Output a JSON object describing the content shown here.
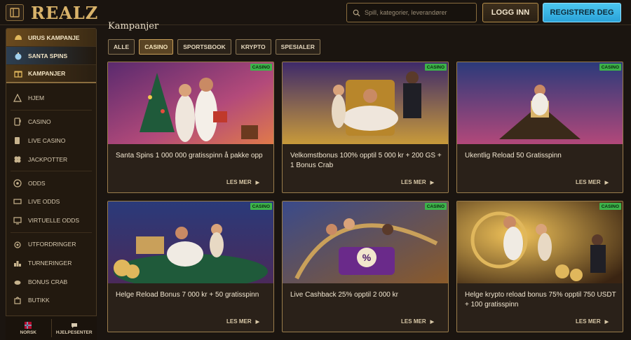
{
  "header": {
    "logo": "REALZ",
    "search_placeholder": "Spill, kategorier, leverandører",
    "login_label": "LOGG INN",
    "register_label": "REGISTRER DEG"
  },
  "sidebar": {
    "promos": [
      {
        "label": "URUS KAMPANJE",
        "icon": "helmet-icon"
      },
      {
        "label": "SANTA SPINS",
        "icon": "ornament-icon"
      },
      {
        "label": "KAMPANJER",
        "icon": "gift-icon"
      }
    ],
    "items": [
      {
        "label": "HJEM",
        "icon": "home-icon"
      },
      {
        "label": "CASINO",
        "icon": "slot-machine-icon"
      },
      {
        "label": "LIVE CASINO",
        "icon": "cards-icon"
      },
      {
        "label": "JACKPOTTER",
        "icon": "clover-icon"
      },
      {
        "label": "ODDS",
        "icon": "ball-icon"
      },
      {
        "label": "LIVE ODDS",
        "icon": "live-icon"
      },
      {
        "label": "VIRTUELLE ODDS",
        "icon": "virtual-icon"
      },
      {
        "label": "UTFORDRINGER",
        "icon": "medal-icon"
      },
      {
        "label": "TURNERINGER",
        "icon": "podium-icon"
      },
      {
        "label": "BONUS CRAB",
        "icon": "crab-icon"
      },
      {
        "label": "BUTIKK",
        "icon": "shop-icon"
      }
    ],
    "footer": {
      "language": "NORSK",
      "help": "HJELPESENTER"
    }
  },
  "main": {
    "title": "Kampanjer",
    "filters": [
      {
        "label": "ALLE",
        "active": false
      },
      {
        "label": "CASINO",
        "active": true
      },
      {
        "label": "SPORTSBOOK",
        "active": false
      },
      {
        "label": "KRYPTO",
        "active": false
      },
      {
        "label": "SPESIALER",
        "active": false
      }
    ],
    "cards": [
      {
        "title": "Santa Spins 1 000 000 gratisspinn å pakke opp",
        "badge": "CASINO",
        "more": "LES MER"
      },
      {
        "title": "Velkomstbonus 100% opptil 5 000 kr + 200 GS + 1 Bonus Crab",
        "badge": "CASINO",
        "more": "LES MER"
      },
      {
        "title": "Ukentlig Reload 50 Gratisspinn",
        "badge": "CASINO",
        "more": "LES MER"
      },
      {
        "title": "Helge Reload Bonus 7 000 kr + 50 gratisspinn",
        "badge": "CASINO",
        "more": "LES MER"
      },
      {
        "title": "Live Cashback 25% opptil 2 000 kr",
        "badge": "CASINO",
        "more": "LES MER"
      },
      {
        "title": "Helge krypto reload bonus 75% opptil 750 USDT + 100 gratisspinn",
        "badge": "CASINO",
        "more": "LES MER"
      }
    ]
  },
  "colors": {
    "accent_gold": "#c9a05a",
    "register_blue": "#2aa2d8",
    "badge_green": "#3db34a",
    "background": "#1b1510"
  }
}
